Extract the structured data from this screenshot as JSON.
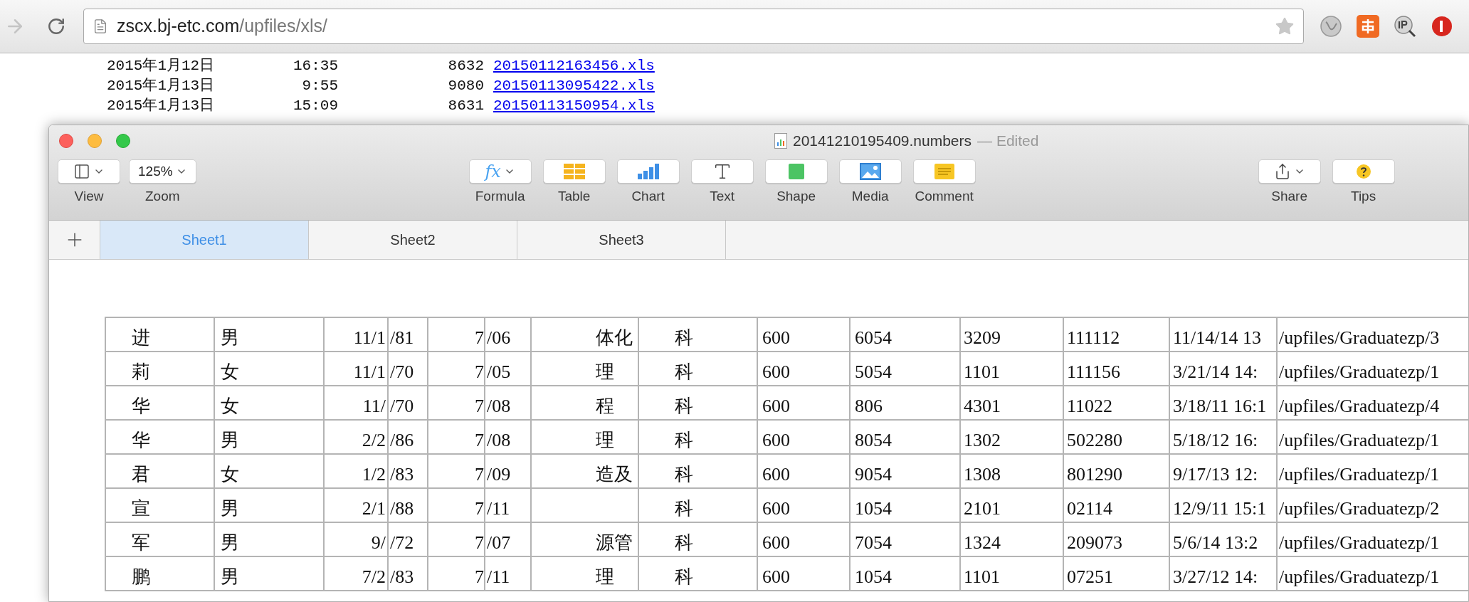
{
  "browser": {
    "back_disabled": true,
    "url": {
      "host": "zscx.bj-etc.com",
      "path": "/upfiles/xls/"
    }
  },
  "listing": [
    {
      "date": "2015年1月12日",
      "time": "16:35",
      "size": "8632",
      "file": "20150112163456.xls"
    },
    {
      "date": "2015年1月13日",
      "time": "9:55",
      "size": "9080",
      "file": "20150113095422.xls"
    },
    {
      "date": "2015年1月13日",
      "time": "15:09",
      "size": "8631",
      "file": "20150113150954.xls"
    }
  ],
  "window": {
    "title": "20141210195409.numbers",
    "status": "— Edited"
  },
  "toolbar": {
    "left": [
      {
        "kind": "view",
        "label": "View",
        "menu": true
      },
      {
        "kind": "zoom",
        "label": "Zoom",
        "value": "125%",
        "menu": true
      }
    ],
    "center": [
      {
        "kind": "formula",
        "label": "Formula",
        "value": "fx",
        "menu": true
      },
      {
        "kind": "table",
        "label": "Table",
        "menu": false
      },
      {
        "kind": "chart",
        "label": "Chart",
        "menu": false
      },
      {
        "kind": "text",
        "label": "Text",
        "menu": false
      },
      {
        "kind": "shape",
        "label": "Shape",
        "menu": false
      },
      {
        "kind": "media",
        "label": "Media",
        "menu": false
      },
      {
        "kind": "comment",
        "label": "Comment",
        "menu": false
      }
    ],
    "right": [
      {
        "kind": "share",
        "label": "Share",
        "menu": true
      },
      {
        "kind": "tips",
        "label": "Tips",
        "menu": false
      }
    ]
  },
  "sheets": [
    {
      "label": "Sheet1",
      "selected": true
    },
    {
      "label": "Sheet2",
      "selected": false
    },
    {
      "label": "Sheet3",
      "selected": false
    }
  ],
  "table": {
    "rows": [
      [
        "进",
        "男",
        "11/1",
        "/81",
        "7",
        "/06",
        "体化",
        "科",
        "600",
        "6054",
        "3209",
        "111112",
        "11/14/14 13",
        "/upfiles/Graduatezp/3"
      ],
      [
        "莉",
        "女",
        "11/1",
        "/70",
        "7",
        "/05",
        "理",
        "科",
        "600",
        "5054",
        "1101",
        "111156",
        "3/21/14 14:",
        "/upfiles/Graduatezp/1"
      ],
      [
        "华",
        "女",
        "11/",
        "/70",
        "7",
        "/08",
        "程",
        "科",
        "600",
        "806",
        "4301",
        "11022",
        "3/18/11 16:1",
        "/upfiles/Graduatezp/4"
      ],
      [
        "华",
        "男",
        "2/2",
        "/86",
        "7",
        "/08",
        "理",
        "科",
        "600",
        "8054",
        "1302",
        "502280",
        "5/18/12 16:",
        "/upfiles/Graduatezp/1"
      ],
      [
        "君",
        "女",
        "1/2",
        "/83",
        "7",
        "/09",
        "造及",
        "科",
        "600",
        "9054",
        "1308",
        "801290",
        "9/17/13 12:",
        "/upfiles/Graduatezp/1"
      ],
      [
        "宣",
        "男",
        "2/1",
        "/88",
        "7",
        "/11",
        null,
        "科",
        "600",
        "1054",
        "2101",
        "02114",
        "12/9/11 15:1",
        "/upfiles/Graduatezp/2"
      ],
      [
        "军",
        "男",
        "9/",
        "/72",
        "7",
        "/07",
        "源管",
        "科",
        "600",
        "7054",
        "1324",
        "209073",
        "5/6/14 13:2",
        "/upfiles/Graduatezp/1"
      ],
      [
        "鹏",
        "男",
        "7/2",
        "/83",
        "7",
        "/11",
        "理",
        "科",
        "600",
        "1054",
        "1101",
        "07251",
        "3/27/12 14:",
        "/upfiles/Graduatezp/1"
      ]
    ]
  }
}
